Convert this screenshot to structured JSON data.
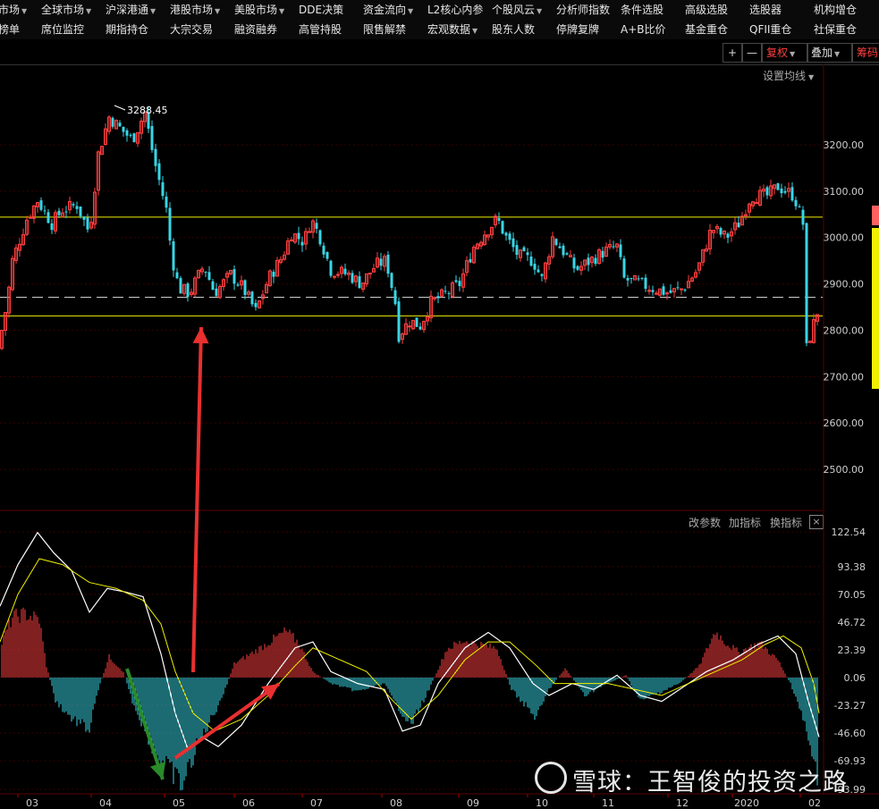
{
  "menu": {
    "row1": [
      {
        "label": "市场",
        "dd": true
      },
      {
        "label": "全球市场",
        "dd": true
      },
      {
        "label": "沪深港通",
        "dd": true
      },
      {
        "label": "港股市场",
        "dd": true
      },
      {
        "label": "美股市场",
        "dd": true
      },
      {
        "label": "DDE决策",
        "dd": false
      },
      {
        "label": "资金流向",
        "dd": true
      },
      {
        "label": "L2核心内参",
        "dd": false
      },
      {
        "label": "个股风云",
        "dd": true
      },
      {
        "label": "分析师指数",
        "dd": false
      },
      {
        "label": "条件选股",
        "dd": false
      },
      {
        "label": "高级选股",
        "dd": false
      },
      {
        "label": "选股器",
        "dd": false
      },
      {
        "label": "机构增仓",
        "dd": false
      }
    ],
    "row2": [
      {
        "label": "榜单",
        "dd": false
      },
      {
        "label": "席位监控",
        "dd": false
      },
      {
        "label": "期指持仓",
        "dd": false
      },
      {
        "label": "大宗交易",
        "dd": false
      },
      {
        "label": "融资融券",
        "dd": false
      },
      {
        "label": "高管持股",
        "dd": false
      },
      {
        "label": "限售解禁",
        "dd": false
      },
      {
        "label": "宏观数据",
        "dd": true
      },
      {
        "label": "股东人数",
        "dd": false
      },
      {
        "label": "停牌复牌",
        "dd": false
      },
      {
        "label": "A+B比价",
        "dd": false
      },
      {
        "label": "基金重仓",
        "dd": false
      },
      {
        "label": "QFII重仓",
        "dd": false
      },
      {
        "label": "社保重仓",
        "dd": false
      }
    ]
  },
  "toolbar": {
    "plus": "+",
    "minus": "—",
    "fuquan": "复权",
    "diejia": "叠加",
    "chouma": "筹码"
  },
  "main_chart": {
    "setting_link": "设置均线",
    "max_label": "3288.45",
    "y_ticks": [
      "3200.00",
      "3100.00",
      "3000.00",
      "2900.00",
      "2800.00",
      "2700.00",
      "2600.00",
      "2500.00"
    ],
    "ylim": [
      2420,
      3340
    ],
    "support_levels": [
      3044,
      2831
    ],
    "dash_level": 2871
  },
  "macd": {
    "links": [
      "改参数",
      "加指标",
      "换指标"
    ],
    "close": "×",
    "y_ticks": [
      "122.54",
      "93.38",
      "70.05",
      "46.72",
      "23.39",
      "0.06",
      "-23.27",
      "-46.60",
      "-69.93",
      "-93.99"
    ],
    "ylim": [
      -93.99,
      122.54
    ]
  },
  "x_axis": [
    "03",
    "04",
    "05",
    "06",
    "07",
    "08",
    "09",
    "10",
    "11",
    "12",
    "2020",
    "02"
  ],
  "watermark": "雪球：王智俊的投资之路",
  "colors": {
    "up": "#ff4040",
    "down": "#38d6e6",
    "yellow": "#f0f000",
    "bg": "#000000",
    "accent": "#ff4040"
  }
}
